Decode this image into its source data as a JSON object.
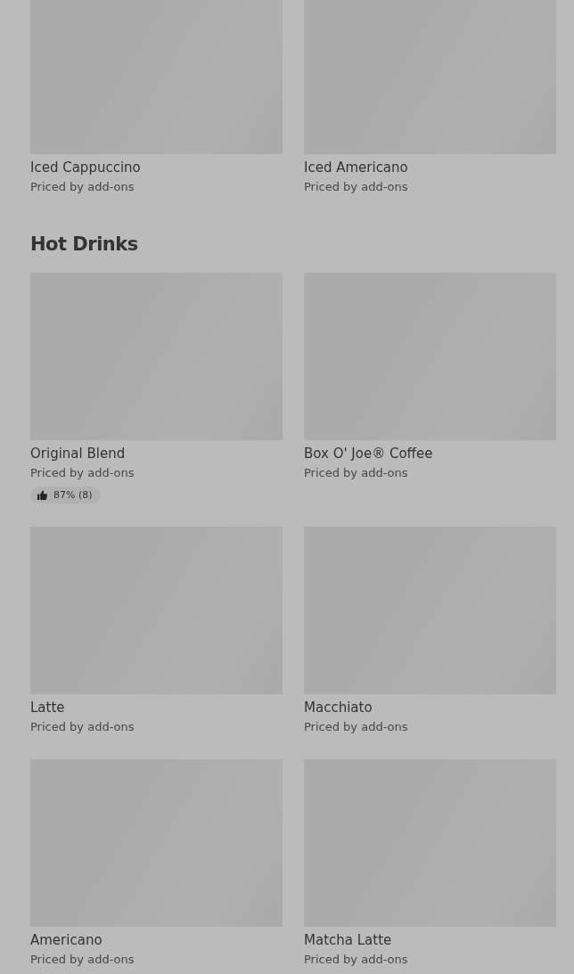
{
  "top_items": [
    {
      "name": "Iced Cappuccino",
      "price": "Priced by add-ons"
    },
    {
      "name": "Iced Americano",
      "price": "Priced by add-ons"
    }
  ],
  "sections": [
    {
      "title": "Hot Drinks",
      "items": [
        {
          "name": "Original Blend",
          "price": "Priced by add-ons",
          "rating": "87% (8)"
        },
        {
          "name": "Box O' Joe® Coffee",
          "price": "Priced by add-ons"
        },
        {
          "name": "Latte",
          "price": "Priced by add-ons"
        },
        {
          "name": "Macchiato",
          "price": "Priced by add-ons"
        },
        {
          "name": "Americano",
          "price": "Priced by add-ons"
        },
        {
          "name": "Matcha Latte",
          "price": "Priced by add-ons"
        }
      ]
    }
  ]
}
